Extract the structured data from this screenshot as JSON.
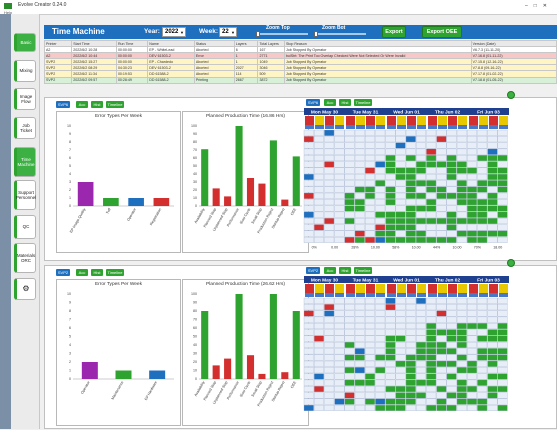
{
  "window": {
    "title": "Evolve Creator 0.24.0",
    "menu": "Help"
  },
  "sidebar": {
    "items": [
      {
        "label": "Basic",
        "active": true
      },
      {
        "label": "Mixing",
        "active": false
      },
      {
        "label": "Image Flow",
        "active": false
      },
      {
        "label": "Job Ticket",
        "active": false
      },
      {
        "label": "Time Machine",
        "active": true
      },
      {
        "label": "Support Personnel",
        "active": false
      },
      {
        "label": "QC",
        "active": false
      },
      {
        "label": "Materials ORC",
        "active": false
      },
      {
        "label": "⚙",
        "active": false
      }
    ]
  },
  "header": {
    "title": "Time Machine",
    "year_label": "Year:",
    "year_value": "2022",
    "week_label": "Week:",
    "week_value": "22",
    "zoom_top_label": "Zoom Top",
    "zoom_bot_label": "Zoom Bot",
    "export_label": "Export",
    "export_oee_label": "Export OEE"
  },
  "job_table": {
    "columns": [
      "Printer",
      "Start Time",
      "Run Time",
      "Name",
      "Status",
      "Layers",
      "Total Layers",
      "Stop Reason",
      "Version (Date)"
    ],
    "rows": [
      [
        "A2",
        "2022/6/2 10:28",
        "00:00:00",
        "EP - WhiteLead",
        "Aborted",
        "6",
        "167",
        "Job Stopped By Operator",
        "V6.7.3 (11-11-20)"
      ],
      [
        "A2",
        "2022/6/2 10:44",
        "00:00:00",
        "DEV 61503-2",
        "Error",
        "1",
        "2771",
        "bulStrt: The Print Too Overlap Checked Were Not Selected Or Were Invalid",
        "V7.16.8 (01-11-22)"
      ],
      [
        "SVP2",
        "2022/6/2 15:27",
        "00:00:00",
        "EP - Chardedo",
        "Aborted",
        "1",
        "1049",
        "Job Stopped By Operator",
        "V7.15.8 (12-16-22)"
      ],
      [
        "SVP2",
        "2022/6/2 08:29",
        "04:30:23",
        "DEV 61503-2",
        "Aborted",
        "2027",
        "3046",
        "Job Stopped By Operator",
        "V7.8.8 (09-16-22)"
      ],
      [
        "SVP2",
        "2022/6/2 11:34",
        "00:19:53",
        "DD 61588-2",
        "Aborted",
        "114",
        "509",
        "Job Stopped By Operator",
        "V7.17.8 (01-02-22)"
      ],
      [
        "SVP2",
        "2022/6/2 09:57",
        "00:28:49",
        "DD 61588-2",
        "Printing",
        "2667",
        "3872",
        "Job Stopped By Operator",
        "V7.18.8 (01-05-22)"
      ]
    ]
  },
  "panel_top": {
    "tags": [
      "SVP6",
      "Acc",
      "Hist",
      "Timeline"
    ],
    "err_chart": {
      "chart_data": {
        "type": "bar",
        "title": "Error Types Per Week",
        "categories": [
          "EP Image Quality",
          "Tuff",
          "Operator",
          "Registration"
        ],
        "values": [
          3,
          1,
          1,
          1
        ],
        "colors": [
          "#9b27af",
          "#2fa32f",
          "#1f6fbf",
          "#d32f2f"
        ],
        "ylim": [
          0,
          10
        ],
        "yticks": [
          "0",
          "1",
          "2",
          "3",
          "4",
          "5",
          "6",
          "7",
          "8",
          "9",
          "10"
        ]
      }
    },
    "prod_chart": {
      "chart_data": {
        "type": "bar",
        "title": "Planned Production Time (16.86 Hrs)",
        "categories": [
          "Availability",
          "Planned Stop",
          "Unplanned Stop",
          "Performance",
          "Slow Cycle",
          "Small Stop",
          "Production Reject",
          "Startup Reject",
          "OEE"
        ],
        "values": [
          71,
          22,
          12,
          100,
          35,
          28,
          82,
          8,
          62
        ],
        "colors": [
          "#2fa32f",
          "#d32f2f",
          "#d32f2f",
          "#2fa32f",
          "#d32f2f",
          "#d32f2f",
          "#2fa32f",
          "#d32f2f",
          "#2fa32f"
        ],
        "ylim": [
          0,
          100
        ],
        "yticks": [
          "0",
          "10",
          "20",
          "30",
          "40",
          "50",
          "60",
          "70",
          "80",
          "90",
          "100"
        ]
      }
    },
    "cal": {
      "tags": [
        "SVP6",
        "Acc",
        "Hist",
        "Timeline"
      ],
      "days": [
        "Mon May 30",
        "Tue May 31",
        "Wed Jun 01",
        "Thu Jun 02",
        "Fri Jun 03"
      ],
      "footer": [
        "0%",
        "0.00",
        "28%",
        "10.00",
        "58%",
        "10.00",
        "44%",
        "10.00",
        "70%",
        "18.00"
      ]
    }
  },
  "panel_bot": {
    "tags": [
      "SVP2",
      "Acc",
      "Hist",
      "Timeline"
    ],
    "err_chart": {
      "chart_data": {
        "type": "bar",
        "title": "Error Types Per Week",
        "categories": [
          "Operator",
          "Maintenance",
          "EP Hardware"
        ],
        "values": [
          2,
          1,
          1
        ],
        "colors": [
          "#9b27af",
          "#2fa32f",
          "#1f6fbf"
        ],
        "ylim": [
          0,
          10
        ],
        "yticks": [
          "0",
          "1",
          "2",
          "3",
          "4",
          "5",
          "6",
          "7",
          "8",
          "9",
          "10"
        ]
      }
    },
    "prod_chart": {
      "chart_data": {
        "type": "bar",
        "title": "Planned Production Time (26.62 Hrs)",
        "categories": [
          "Availability",
          "Planned Stop",
          "Unplanned Stop",
          "Performance",
          "Slow Cycle",
          "Small Stop",
          "Production Reject",
          "Startup Reject",
          "OEE"
        ],
        "values": [
          80,
          16,
          24,
          100,
          28,
          6,
          100,
          8,
          80
        ],
        "colors": [
          "#2fa32f",
          "#d32f2f",
          "#d32f2f",
          "#2fa32f",
          "#d32f2f",
          "#d32f2f",
          "#2fa32f",
          "#d32f2f",
          "#2fa32f"
        ],
        "ylim": [
          0,
          100
        ],
        "yticks": [
          "0",
          "10",
          "20",
          "30",
          "40",
          "50",
          "60",
          "70",
          "80",
          "90",
          "100"
        ]
      }
    },
    "cal": {
      "tags": [
        "SVP2",
        "Acc",
        "Hist",
        "Timeline"
      ],
      "days": [
        "Mon May 30",
        "Tue May 31",
        "Wed Jun 01",
        "Thu Jun 02",
        "Fri Jun 03"
      ],
      "footer": []
    }
  }
}
